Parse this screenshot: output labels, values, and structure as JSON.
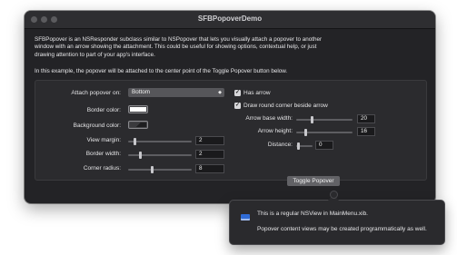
{
  "window": {
    "title": "SFBPopoverDemo",
    "description_line1": "SFBPopover is an NSResponder subclass similar to NSPopover that lets you visually attach a popover to another",
    "description_line2": "window with an arrow showing the attachment. This could be useful for showing options, contextual help, or just",
    "description_line3": "drawing attention to part of your app's interface.",
    "description2": "In this example, the popover will be attached to the center point of the Toggle Popover button below."
  },
  "left": {
    "attach_label": "Attach popover on:",
    "attach_value": "Bottom",
    "border_color_label": "Border color:",
    "border_color": "#ffffff",
    "background_color_label": "Background color:",
    "background_color": "#2a2a2d",
    "view_margin_label": "View margin:",
    "view_margin_value": "2",
    "border_width_label": "Border width:",
    "border_width_value": "2",
    "corner_radius_label": "Corner radius:",
    "corner_radius_value": "8"
  },
  "right": {
    "has_arrow_label": "Has arrow",
    "has_arrow_checked": true,
    "draw_round_corner_label": "Draw round corner beside arrow",
    "draw_round_corner_checked": true,
    "arrow_base_width_label": "Arrow base width:",
    "arrow_base_width_value": "20",
    "arrow_height_label": "Arrow height:",
    "arrow_height_value": "16",
    "distance_label": "Distance:",
    "distance_value": "0"
  },
  "toggle_button_label": "Toggle Popover",
  "popover": {
    "line1": "This is a regular NSView in MainMenu.xib.",
    "line2": "Popover content views may be created programmatically as well."
  },
  "icons": {
    "checkmark": "checkmark-icon",
    "popup_chevron": "updown-chevron-icon",
    "view_icon": "nsview-icon"
  }
}
